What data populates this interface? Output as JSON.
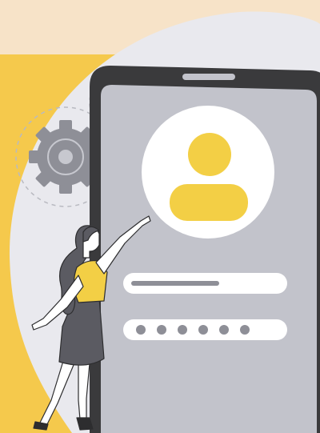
{
  "illustration": {
    "colors": {
      "top_band": "#f7e3c8",
      "yellow_bg": "#f5c94c",
      "blob": "#e9e9ee",
      "phone_body": "#3a3a3c",
      "screen": "#c2c3cb",
      "avatar_circle": "#ffffff",
      "avatar_figure": "#f3cf45",
      "gear": "#8e8f97",
      "field": "#ffffff",
      "field_line": "#8e8f97",
      "password_dot": "#8e8f97",
      "shirt": "#f3cf45",
      "skirt": "#5b5b62",
      "hair": "#5b5b62",
      "skin": "#ffffff",
      "outline": "#2d2d2f"
    },
    "icons": {
      "avatar": "user-icon",
      "gears": "gear-icon",
      "password": "password-dots-icon"
    },
    "password_dot_count": 6
  }
}
